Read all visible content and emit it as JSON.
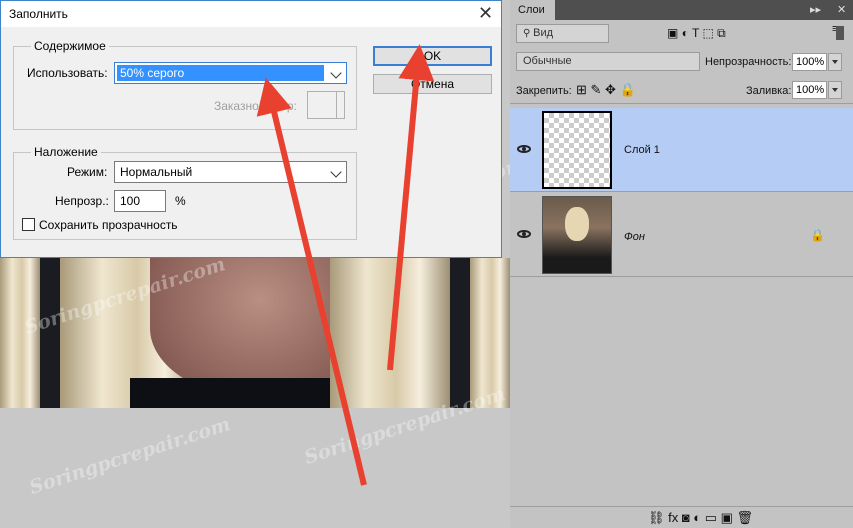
{
  "dialog": {
    "title": "Заполнить",
    "contents_group": "Содержимое",
    "use_label": "Использовать:",
    "use_value": "50% серого",
    "custom_pattern_label": "Заказной узор:",
    "blending_group": "Наложение",
    "mode_label": "Режим:",
    "mode_value": "Нормальный",
    "opacity_label": "Непрозр.:",
    "opacity_value": "100",
    "opacity_unit": "%",
    "preserve_label": "Сохранить прозрачность",
    "ok_label": "OK",
    "cancel_label": "Отмена"
  },
  "panel": {
    "tab_title": "Слои",
    "filter_value": "Вид",
    "blend_mode": "Обычные",
    "opacity_label": "Непрозрачность:",
    "opacity_value": "100%",
    "lock_label": "Закрепить:",
    "fill_label": "Заливка:",
    "fill_value": "100%",
    "layers": [
      {
        "name": "Слой 1",
        "selected": true
      },
      {
        "name": "Фон",
        "selected": false,
        "locked": true
      }
    ]
  },
  "watermark": "Soringpcrepair.com",
  "colors": {
    "accent": "#3392ff",
    "selected_layer": "#b5cdf5",
    "arrow": "#e8412f"
  }
}
